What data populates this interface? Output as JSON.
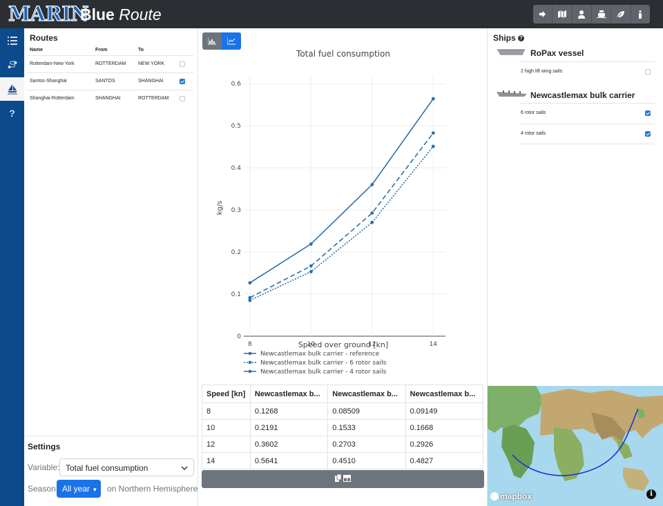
{
  "header": {
    "logo": "MARIN",
    "brand_bold": "Blue",
    "brand_italic": "Route"
  },
  "header_icons": [
    "logout-icon",
    "map-icon",
    "user-icon",
    "ship-icon",
    "leaf-icon",
    "info-icon"
  ],
  "nav": {
    "items": [
      "list-icon",
      "route-icon",
      "sailboat-icon",
      "question-icon"
    ],
    "active_index": 2
  },
  "routes": {
    "title": "Routes",
    "columns": [
      "Name",
      "From",
      "To"
    ],
    "rows": [
      {
        "name": "Rotterdam-New York",
        "from": "ROTTERDAM",
        "to": "NEW YORK",
        "checked": false
      },
      {
        "name": "Santos-Shanghai",
        "from": "SANTOS",
        "to": "SHANGHAI",
        "checked": true
      },
      {
        "name": "Shanghai-Rotterdam",
        "from": "SHANGHAI",
        "to": "ROTTERDAM",
        "checked": false
      }
    ]
  },
  "settings": {
    "title": "Settings",
    "variable_label": "Variable:",
    "variable_value": "Total fuel consumption",
    "season_label": "Season:",
    "season_value": "All year",
    "hemisphere_text": "on Northern Hemisphere"
  },
  "chart_data": {
    "type": "line",
    "title": "Total fuel consumption",
    "xlabel": "Speed over ground [kn]",
    "ylabel": "kg/s",
    "x": [
      8,
      10,
      12,
      14
    ],
    "xticks": [
      "8",
      "10",
      "12",
      "14"
    ],
    "yticks": [
      "0",
      "0.1",
      "0.2",
      "0.3",
      "0.4",
      "0.5",
      "0.6"
    ],
    "xlim": [
      7.8,
      14.4
    ],
    "ylim": [
      0,
      0.62
    ],
    "grid": true,
    "color": "#2c6ea5",
    "series": [
      {
        "name": "Newcastlemax bulk carrier - reference",
        "values": [
          0.1268,
          0.2191,
          0.3602,
          0.5641
        ],
        "dash": "solid"
      },
      {
        "name": "Newcastlemax bulk carrier - 6 rotor sails",
        "values": [
          0.08509,
          0.1533,
          0.2703,
          0.451
        ],
        "dash": "dot"
      },
      {
        "name": "Newcastlemax bulk carrier - 4 rotor sails",
        "values": [
          0.09149,
          0.1668,
          0.2926,
          0.4827
        ],
        "dash": "dash"
      }
    ],
    "legend_position": "bottom-left"
  },
  "table": {
    "headers": [
      "Speed [kn]",
      "Newcastlemax b...",
      "Newcastlemax b...",
      "Newcastlemax b..."
    ],
    "rows": [
      [
        "8",
        "0.1268",
        "0.08509",
        "0.09149"
      ],
      [
        "10",
        "0.2191",
        "0.1533",
        "0.1668"
      ],
      [
        "12",
        "0.3602",
        "0.2703",
        "0.2926"
      ],
      [
        "14",
        "0.5641",
        "0.4510",
        "0.4827"
      ]
    ]
  },
  "ships": {
    "title": "Ships",
    "items": [
      {
        "name": "RoPax vessel",
        "sails": [
          {
            "label": "2 high lift wing sails",
            "checked": false
          }
        ]
      },
      {
        "name": "Newcastlemax bulk carrier",
        "sails": [
          {
            "label": "6 rotor sails",
            "checked": true
          },
          {
            "label": "4 rotor sails",
            "checked": true
          }
        ]
      }
    ]
  },
  "map": {
    "attribution": "mapbox"
  }
}
